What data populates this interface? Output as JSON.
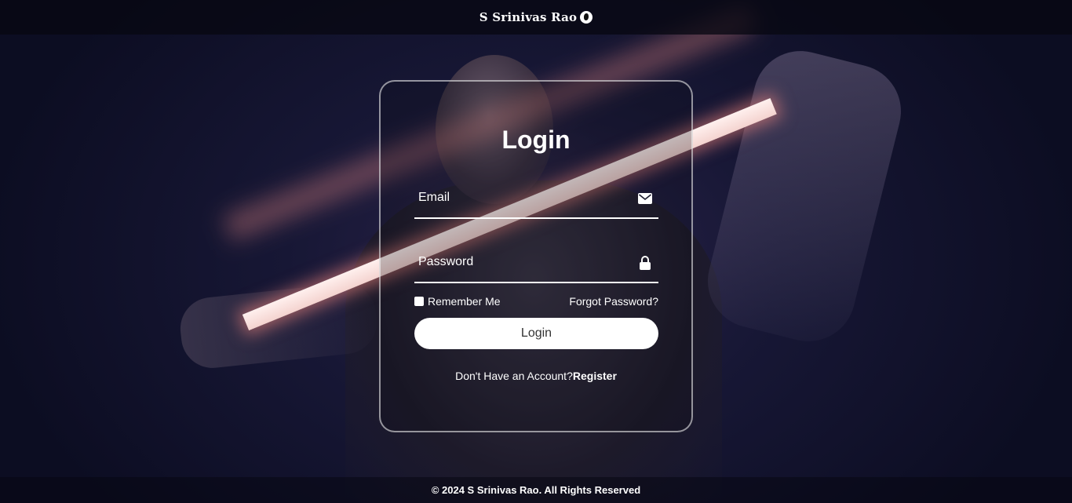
{
  "header": {
    "brand": "S Srinivas Rao",
    "brand_icon": "globe-icon"
  },
  "login_form": {
    "title": "Login",
    "email": {
      "placeholder": "Email",
      "value": "",
      "icon": "envelope-icon"
    },
    "password": {
      "placeholder": "Password",
      "value": "",
      "icon": "lock-icon"
    },
    "remember_label": "Remember Me",
    "remember_checked": false,
    "forgot_label": "Forgot Password?",
    "submit_label": "Login",
    "register_prompt": "Don't Have an Account?",
    "register_label": "Register"
  },
  "footer": {
    "copyright": "© 2024 S Srinivas Rao. All Rights Reserved"
  },
  "colors": {
    "background": "#171735",
    "card_border": "#ffffff",
    "button_bg": "#ffffff",
    "button_text": "#333333",
    "text": "#ffffff"
  }
}
